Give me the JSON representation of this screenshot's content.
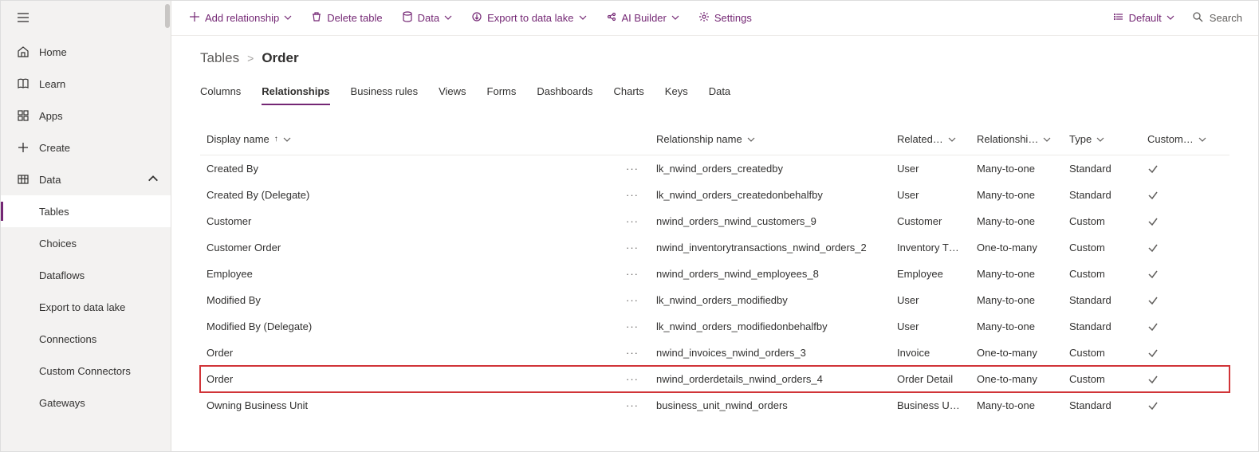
{
  "sidebar": {
    "items": [
      {
        "icon": "home",
        "label": "Home"
      },
      {
        "icon": "book",
        "label": "Learn"
      },
      {
        "icon": "apps",
        "label": "Apps"
      },
      {
        "icon": "plus",
        "label": "Create"
      },
      {
        "icon": "grid",
        "label": "Data",
        "expanded": true
      }
    ],
    "data_sub": [
      {
        "label": "Tables",
        "active": true
      },
      {
        "label": "Choices"
      },
      {
        "label": "Dataflows"
      },
      {
        "label": "Export to data lake"
      },
      {
        "label": "Connections"
      },
      {
        "label": "Custom Connectors"
      },
      {
        "label": "Gateways"
      }
    ]
  },
  "commandbar": {
    "add": "Add relationship",
    "delete": "Delete table",
    "data": "Data",
    "export": "Export to data lake",
    "ai": "AI Builder",
    "settings": "Settings",
    "default": "Default",
    "search": "Search"
  },
  "breadcrumb": {
    "root": "Tables",
    "sep": ">",
    "leaf": "Order"
  },
  "tabs": [
    "Columns",
    "Relationships",
    "Business rules",
    "Views",
    "Forms",
    "Dashboards",
    "Charts",
    "Keys",
    "Data"
  ],
  "active_tab": "Relationships",
  "columns": {
    "display": "Display name",
    "relname": "Relationship name",
    "related": "Related…",
    "relship": "Relationshi…",
    "type": "Type",
    "custom": "Custom…"
  },
  "rows": [
    {
      "display": "Created By",
      "relname": "lk_nwind_orders_createdby",
      "related": "User",
      "relship": "Many-to-one",
      "type": "Standard"
    },
    {
      "display": "Created By (Delegate)",
      "relname": "lk_nwind_orders_createdonbehalfby",
      "related": "User",
      "relship": "Many-to-one",
      "type": "Standard"
    },
    {
      "display": "Customer",
      "relname": "nwind_orders_nwind_customers_9",
      "related": "Customer",
      "relship": "Many-to-one",
      "type": "Custom"
    },
    {
      "display": "Customer Order",
      "relname": "nwind_inventorytransactions_nwind_orders_2",
      "related": "Inventory T…",
      "relship": "One-to-many",
      "type": "Custom"
    },
    {
      "display": "Employee",
      "relname": "nwind_orders_nwind_employees_8",
      "related": "Employee",
      "relship": "Many-to-one",
      "type": "Custom"
    },
    {
      "display": "Modified By",
      "relname": "lk_nwind_orders_modifiedby",
      "related": "User",
      "relship": "Many-to-one",
      "type": "Standard"
    },
    {
      "display": "Modified By (Delegate)",
      "relname": "lk_nwind_orders_modifiedonbehalfby",
      "related": "User",
      "relship": "Many-to-one",
      "type": "Standard"
    },
    {
      "display": "Order",
      "relname": "nwind_invoices_nwind_orders_3",
      "related": "Invoice",
      "relship": "One-to-many",
      "type": "Custom"
    },
    {
      "display": "Order",
      "relname": "nwind_orderdetails_nwind_orders_4",
      "related": "Order Detail",
      "relship": "One-to-many",
      "type": "Custom",
      "highlight": true
    },
    {
      "display": "Owning Business Unit",
      "relname": "business_unit_nwind_orders",
      "related": "Business U…",
      "relship": "Many-to-one",
      "type": "Standard"
    }
  ]
}
